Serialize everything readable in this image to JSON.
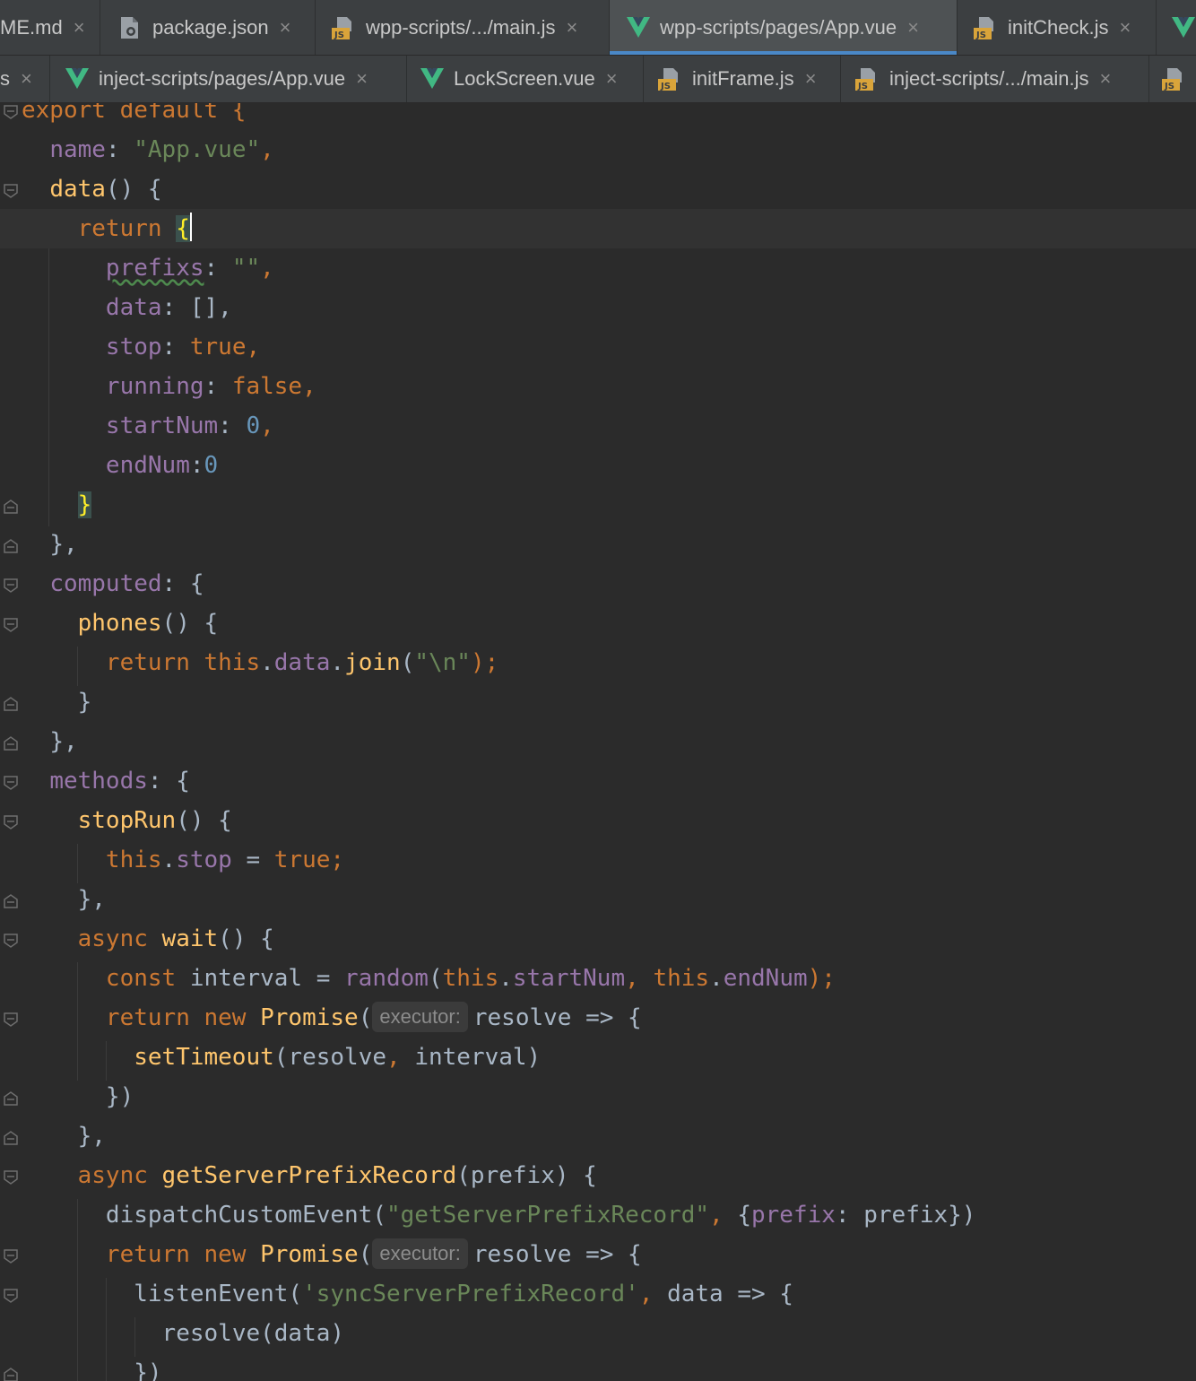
{
  "tabs_row1": [
    {
      "label": "ME.md",
      "icon": "markdown-file-icon",
      "active": false
    },
    {
      "label": "package.json",
      "icon": "json-file-icon",
      "active": false
    },
    {
      "label": "wpp-scripts/.../main.js",
      "icon": "js-file-icon",
      "active": false
    },
    {
      "label": "wpp-scripts/pages/App.vue",
      "icon": "vue-file-icon",
      "active": true
    },
    {
      "label": "initCheck.js",
      "icon": "js-file-icon",
      "active": false
    }
  ],
  "tabs_row2": [
    {
      "label": "s",
      "icon": "",
      "active": false
    },
    {
      "label": "inject-scripts/pages/App.vue",
      "icon": "vue-file-icon",
      "active": false
    },
    {
      "label": "LockScreen.vue",
      "icon": "vue-file-icon",
      "active": false
    },
    {
      "label": "initFrame.js",
      "icon": "js-file-icon",
      "active": false
    },
    {
      "label": "inject-scripts/.../main.js",
      "icon": "js-file-icon",
      "active": false
    }
  ],
  "close_glyph": "×",
  "code": {
    "l01": [
      "export default {"
    ],
    "l02": [
      "name",
      ": ",
      "\"App.vue\"",
      ","
    ],
    "l03": [
      "data",
      "() {"
    ],
    "l04": [
      "return ",
      "{"
    ],
    "l05": [
      "prefixs",
      ": ",
      "\"\"",
      ","
    ],
    "l06": [
      "data",
      ": [],"
    ],
    "l07": [
      "stop",
      ": ",
      "true",
      ","
    ],
    "l08": [
      "running",
      ": ",
      "false",
      ","
    ],
    "l09": [
      "startNum",
      ": ",
      "0",
      ","
    ],
    "l10": [
      "endNum",
      ":",
      "0"
    ],
    "l11": [
      "}"
    ],
    "l12": [
      "},"
    ],
    "l13": [
      "computed",
      ": {"
    ],
    "l14": [
      "phones",
      "() {"
    ],
    "l15": [
      "return ",
      "this",
      ".",
      "data",
      ".",
      "join",
      "(",
      "\"\\n\"",
      ");"
    ],
    "l16": [
      "}"
    ],
    "l17": [
      "},"
    ],
    "l18": [
      "methods",
      ": {"
    ],
    "l19": [
      "stopRun",
      "() {"
    ],
    "l20": [
      "this",
      ".",
      "stop",
      " = ",
      "true",
      ";"
    ],
    "l21": [
      "},"
    ],
    "l22": [
      "async ",
      "wait",
      "() {"
    ],
    "l23": [
      "const ",
      "interval = ",
      "random",
      "(",
      "this",
      ".",
      "startNum",
      ", ",
      "this",
      ".",
      "endNum",
      ");"
    ],
    "l24": [
      "return ",
      "new ",
      "Promise",
      "(",
      "executor:",
      "resolve => {"
    ],
    "l25": [
      "setTimeout",
      "(resolve",
      ", ",
      "interval)"
    ],
    "l26": [
      "})"
    ],
    "l27": [
      "},"
    ],
    "l28": [
      "async ",
      "getServerPrefixRecord",
      "(prefix) {"
    ],
    "l29": [
      "dispatchCustomEvent(",
      "\"getServerPrefixRecord\"",
      ", ",
      "{",
      "prefix",
      ": prefix})"
    ],
    "l30": [
      "return ",
      "new ",
      "Promise",
      "(",
      "executor:",
      "resolve => {"
    ],
    "l31": [
      "listenEvent(",
      "'syncServerPrefixRecord'",
      ", ",
      "data => {"
    ],
    "l32": [
      "resolve(data)"
    ],
    "l33": [
      "})"
    ]
  }
}
